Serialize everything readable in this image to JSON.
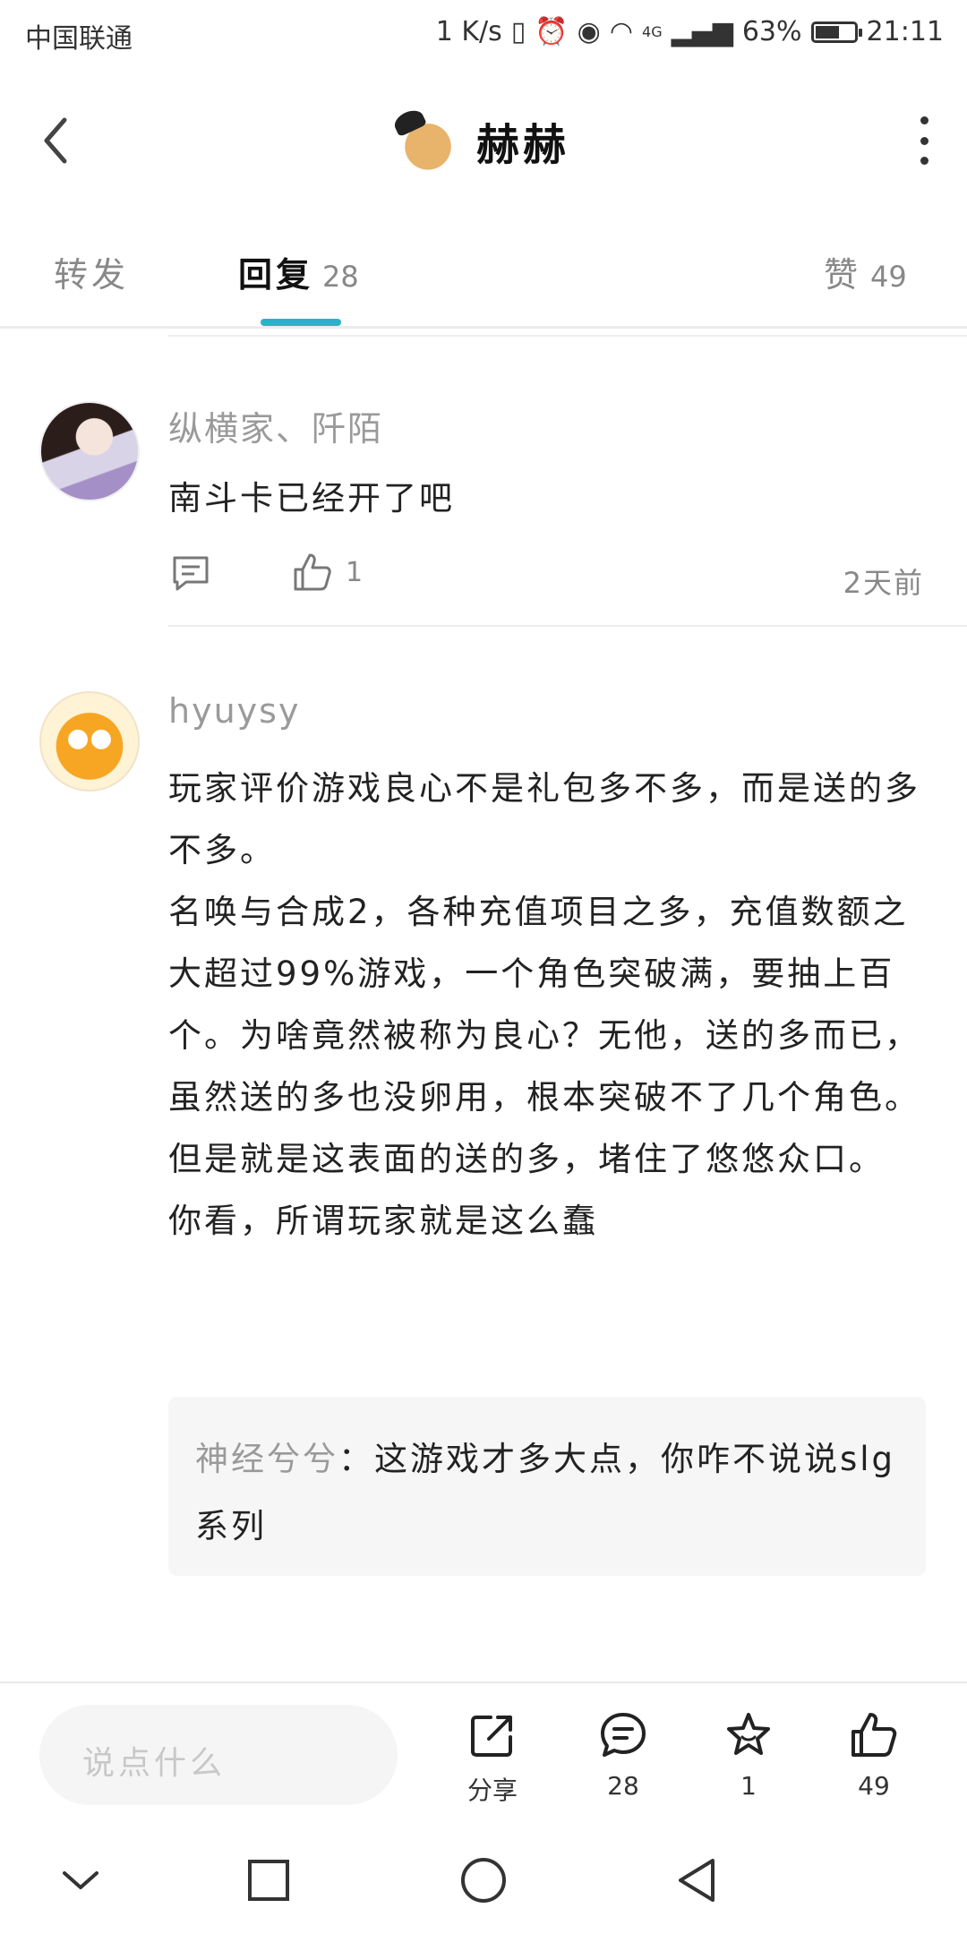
{
  "status_bar": {
    "carrier": "中国联通",
    "speed": "1 K/s",
    "network": "4G",
    "battery": "63%",
    "battery_level": 0.63,
    "time": "21:11"
  },
  "header": {
    "title": "赫赫"
  },
  "tabs": [
    {
      "label": "转发",
      "count": ""
    },
    {
      "label": "回复",
      "count": "28"
    },
    {
      "label": "赞",
      "count": "49"
    }
  ],
  "comments": [
    {
      "author": "纵横家、阡陌",
      "text": "南斗卡已经开了吧",
      "likes": "1",
      "time": "2天前"
    },
    {
      "author": "hyuysy",
      "text": "玩家评价游戏良心不是礼包多不多，而是送的多不多。\n名唤与合成2，各种充值项目之多，充值数额之大超过99%游戏，一个角色突破满，要抽上百个。为啥竟然被称为良心？无他，送的多而已，虽然送的多也没卵用，根本突破不了几个角色。但是就是这表面的送的多，堵住了悠悠众口。\n你看，所谓玩家就是这么蠢",
      "reply_author": "神经兮兮",
      "reply_sep": "：",
      "reply_text": "这游戏才多大点，你咋不说说slg系列"
    }
  ],
  "bottom_bar": {
    "input_placeholder": "说点什么",
    "share_label": "分享",
    "comment_count": "28",
    "favorite_count": "1",
    "like_count": "49"
  }
}
